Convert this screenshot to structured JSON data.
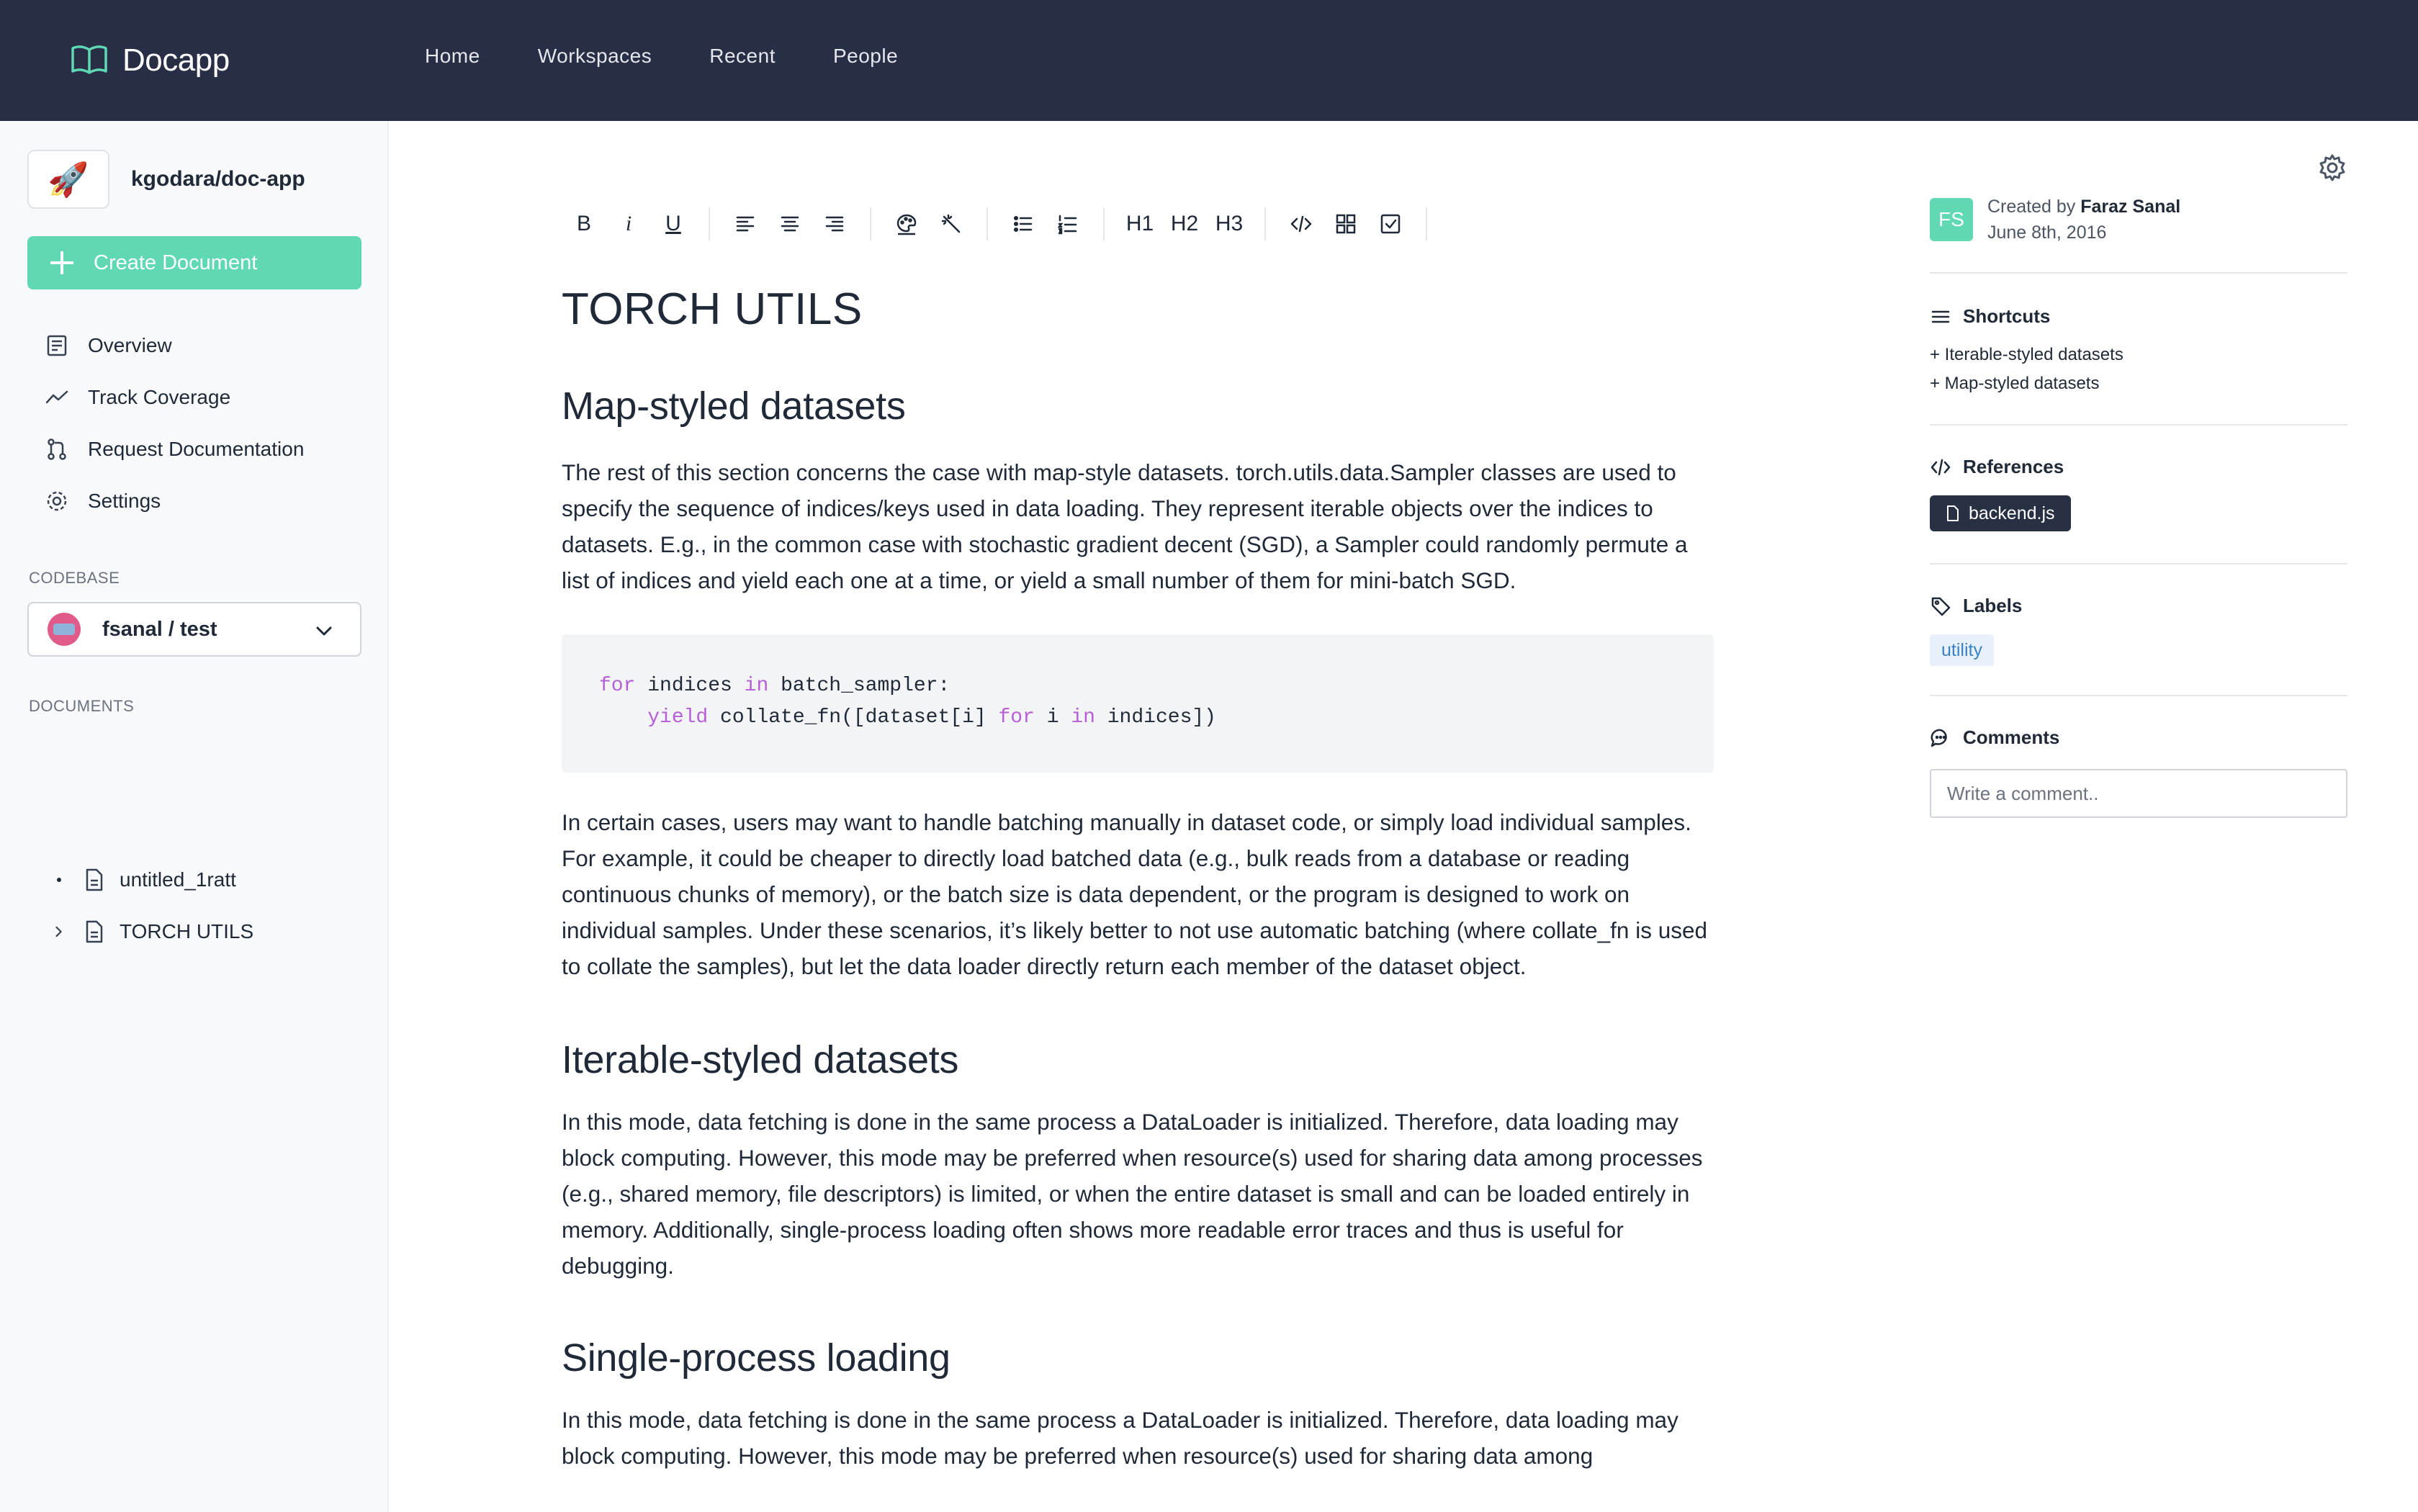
{
  "app": {
    "name": "Docapp"
  },
  "nav": {
    "items": [
      "Home",
      "Workspaces",
      "Recent",
      "People"
    ]
  },
  "sidebar": {
    "repo": {
      "name": "kgodara/doc-app"
    },
    "create_label": "Create Document",
    "menu": [
      {
        "label": "Overview",
        "icon": "overview-icon"
      },
      {
        "label": "Track Coverage",
        "icon": "trend-icon"
      },
      {
        "label": "Request Documentation",
        "icon": "pull-request-icon"
      },
      {
        "label": "Settings",
        "icon": "gear-icon"
      }
    ],
    "codebase_label": "CODEBASE",
    "codebase_value": "fsanal / test",
    "documents_label": "DOCUMENTS",
    "documents": [
      "untitled_1ratt",
      "TORCH UTILS"
    ]
  },
  "toolbar": {
    "bold": "B",
    "italic": "i",
    "underline": "U",
    "h1": "H1",
    "h2": "H2",
    "h3": "H3"
  },
  "document": {
    "title": "TORCH UTILS",
    "h_map": "Map-styled datasets",
    "p_map": "The rest of this section concerns the case with map-style datasets. torch.utils.data.Sampler classes are used to specify the sequence of indices/keys used in data loading. They represent iterable objects over the indices to datasets. E.g., in the common case with stochastic gradient decent (SGD), a Sampler could randomly permute a list of indices and yield each one at a time, or yield a small number of them for mini-batch SGD.",
    "code": {
      "kw_for": "for",
      "l1_a": " indices ",
      "kw_in": "in",
      "l1_b": " batch_sampler:",
      "kw_yield": "yield",
      "l2_a": " collate_fn([dataset[i] ",
      "kw_for2": "for",
      "l2_b": " i ",
      "kw_in2": "in",
      "l2_c": " indices])"
    },
    "p_cases": "In certain cases, users may want to handle batching manually in dataset code, or simply load individual samples. For example, it could be cheaper to directly load batched data (e.g., bulk reads from a database or reading continuous chunks of memory), or the batch size is data dependent, or the program is designed to work on individual samples. Under these scenarios, it’s likely better to not use automatic batching (where collate_fn is used to collate the samples), but let the data loader directly return each member of the dataset object.",
    "h_iter": "Iterable-styled datasets",
    "p_iter": "In this mode, data fetching is done in the same process a DataLoader is initialized. Therefore, data loading may block computing. However, this mode may be preferred when resource(s) used for sharing data among processes (e.g., shared memory, file descriptors) is limited, or when the entire dataset is small and can be loaded entirely in memory. Additionally, single-process loading often shows more readable error traces and thus is useful for debugging.",
    "h_single": "Single-process loading",
    "p_single": "In this mode, data fetching is done in the same process a DataLoader is initialized. Therefore, data loading may block computing. However, this mode may be preferred when resource(s) used for sharing data among"
  },
  "panel": {
    "avatar_initials": "FS",
    "created_by_prefix": "Created by ",
    "created_by": "Faraz Sanal",
    "created_date": "June 8th, 2016",
    "shortcuts_title": "Shortcuts",
    "shortcuts": [
      "+ Iterable-styled datasets",
      "+ Map-styled datasets"
    ],
    "references_title": "References",
    "reference": "backend.js",
    "labels_title": "Labels",
    "label": "utility",
    "comments_title": "Comments",
    "comment_placeholder": "Write a comment.."
  },
  "colors": {
    "topbar": "#272e45",
    "accent": "#5fd8b3",
    "keyword": "#b65fd6",
    "chip_dark": "#273143",
    "label_bg": "#e8f1fb"
  }
}
